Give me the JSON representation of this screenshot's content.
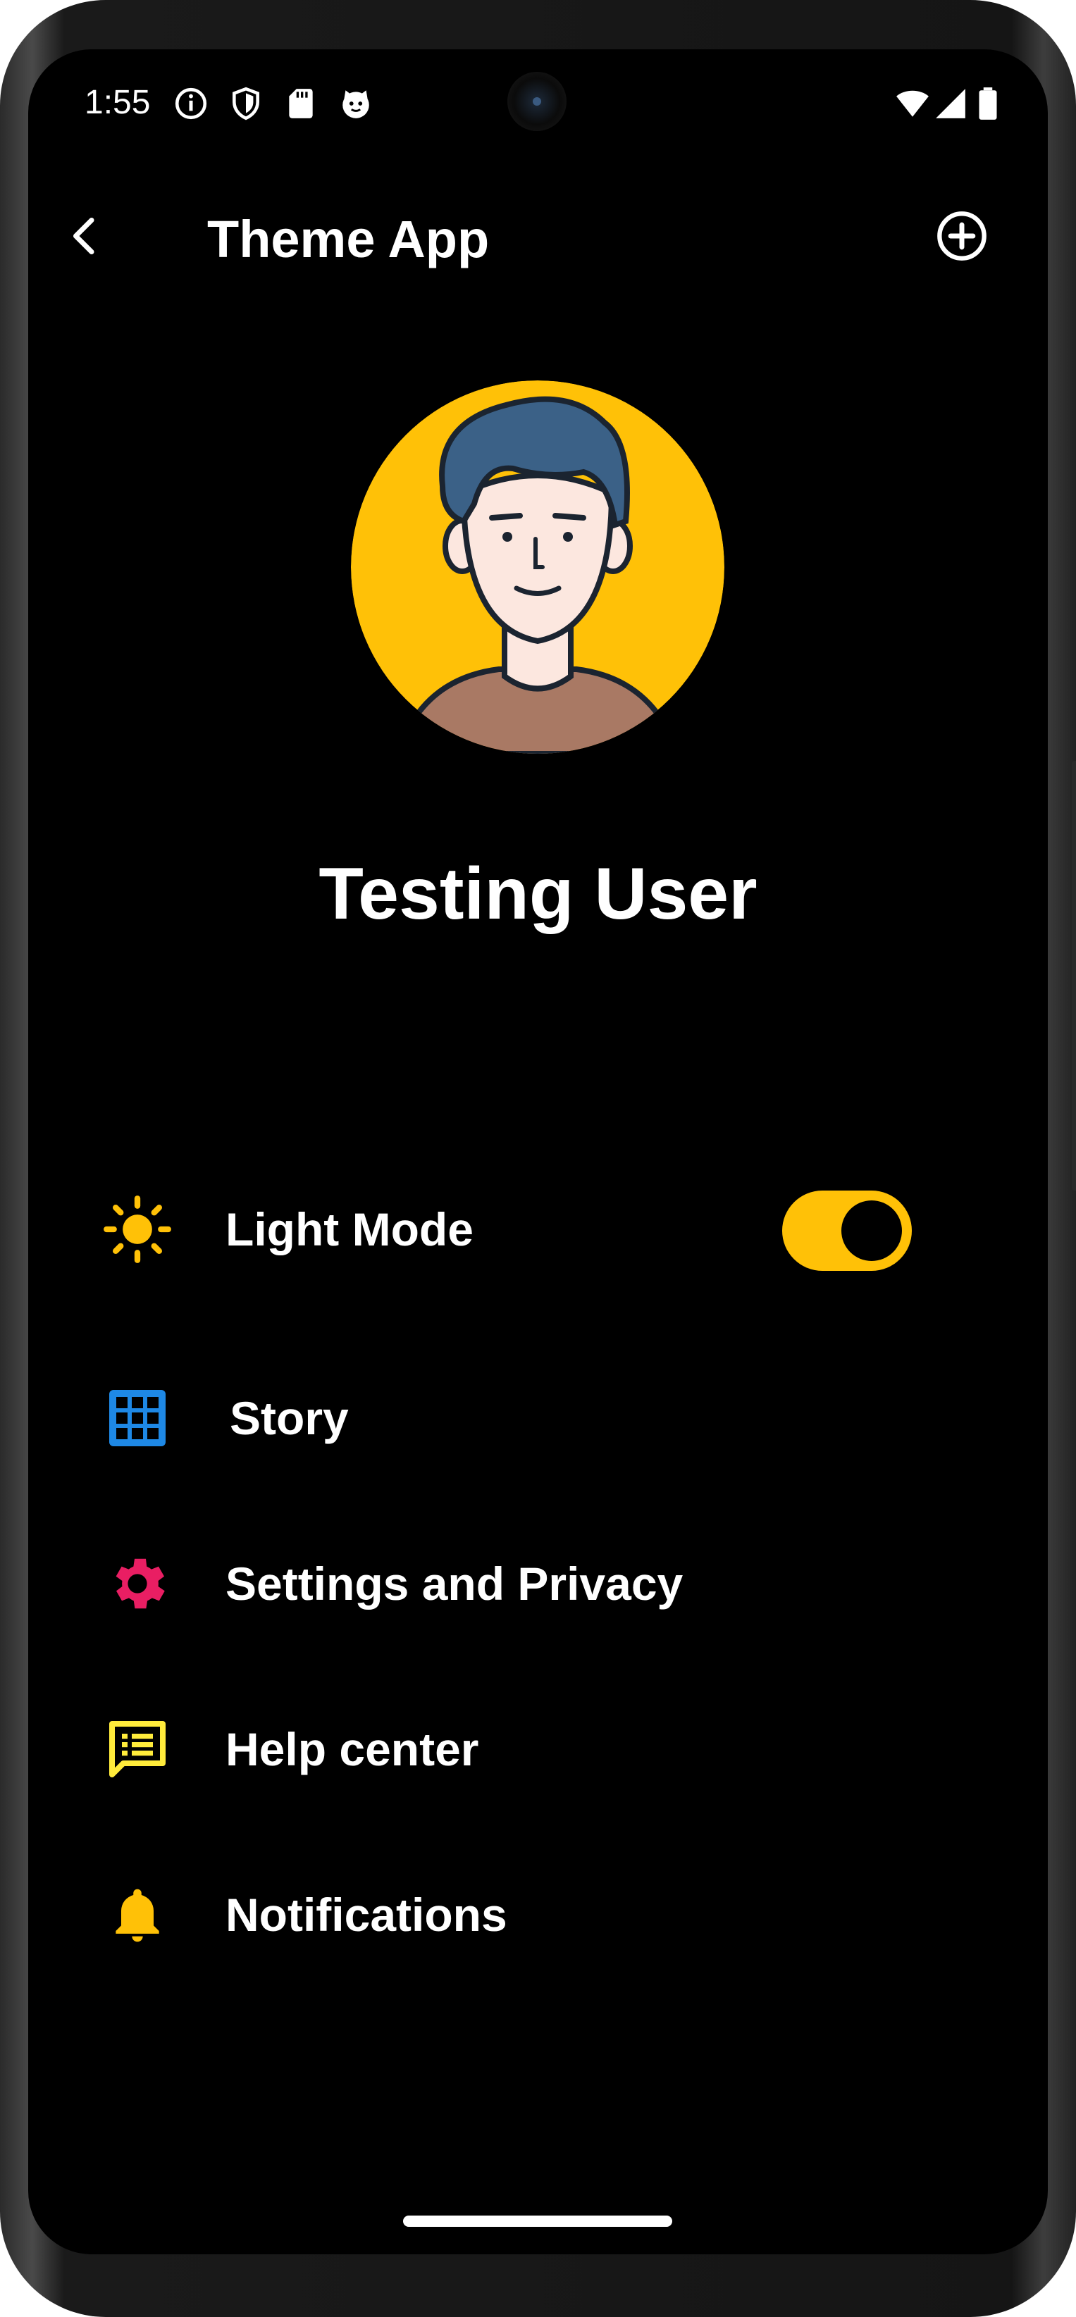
{
  "status_bar": {
    "time": "1:55",
    "icons": [
      "info-icon",
      "shield-icon",
      "sd-card-icon",
      "cat-icon"
    ],
    "right_icons": [
      "wifi-icon",
      "signal-icon",
      "battery-icon"
    ]
  },
  "app_bar": {
    "title": "Theme App",
    "back_icon": "chevron-left-icon",
    "add_icon": "add-circle-icon"
  },
  "profile": {
    "name": "Testing User",
    "avatar_bg": "#FFC107"
  },
  "menu": {
    "items": [
      {
        "label": "Light Mode",
        "icon": "sun-icon",
        "color": "#FFC107"
      },
      {
        "label": "Story",
        "icon": "grid-icon",
        "color": "#1E88E5"
      },
      {
        "label": "Settings and Privacy",
        "icon": "gear-icon",
        "color": "#E91E63"
      },
      {
        "label": "Help center",
        "icon": "feedback-icon",
        "color": "#FFEB3B"
      },
      {
        "label": "Notifications",
        "icon": "bell-icon",
        "color": "#FFC107"
      }
    ],
    "light_mode_toggle": true,
    "toggle_color": "#FFC107"
  }
}
